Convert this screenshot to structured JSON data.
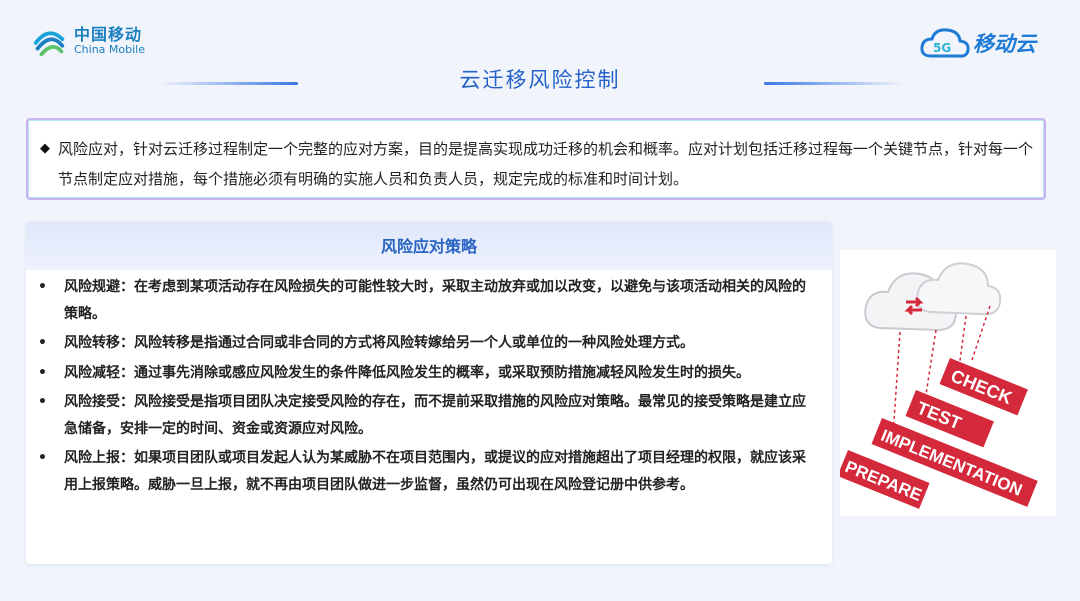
{
  "header": {
    "logo_left_cn": "中国移动",
    "logo_left_en": "China Mobile",
    "logo_right_badge": "5G",
    "logo_right_text": "移动云",
    "title": "云迁移风险控制"
  },
  "intro": {
    "text": "风险应对，针对云迁移过程制定一个完整的应对方案，目的是提高实现成功迁移的机会和概率。应对计划包括迁移过程每一个关键节点，针对每一个节点制定应对措施，每个措施必须有明确的实施人员和负责人员，规定完成的标准和时间计划。"
  },
  "panel": {
    "heading": "风险应对策略",
    "items": [
      {
        "text": "风险规避：在考虑到某项活动存在风险损失的可能性较大时，采取主动放弃或加以改变，以避免与该项活动相关的风险的策略。"
      },
      {
        "text": "风险转移：风险转移是指通过合同或非合同的方式将风险转嫁给另一个人或单位的一种风险处理方式。"
      },
      {
        "text": "风险减轻：通过事先消除或感应风险发生的条件降低风险发生的概率，或采取预防措施减轻风险发生时的损失。"
      },
      {
        "text": "风险接受：风险接受是指项目团队决定接受风险的存在，而不提前采取措施的风险应对策略。最常见的接受策略是建立应急储备，安排一定的时间、资金或资源应对风险。"
      },
      {
        "text": "风险上报：如果项目团队或项目发起人认为某威胁不在项目范围内，或提议的应对措施超出了项目经理的权限，就应该采用上报策略。威胁一旦上报，就不再由项目团队做进一步监督，虽然仍可出现在风险登记册中供参考。"
      }
    ]
  },
  "illustration": {
    "steps": [
      "CHECK",
      "TEST",
      "IMPLEMENTATION",
      "PREPARE"
    ],
    "accent_color": "#d4293a"
  },
  "colors": {
    "title": "#2462c9",
    "brand_blue": "#1b7fc0",
    "background": "#f1f4fb"
  }
}
